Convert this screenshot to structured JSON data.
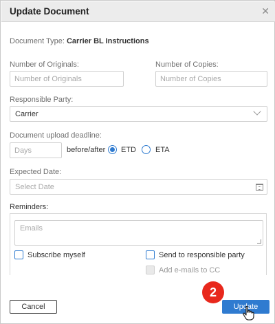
{
  "dialog": {
    "title": "Update Document",
    "close_icon": "close-icon"
  },
  "document_type": {
    "label": "Document Type:",
    "value": "Carrier BL Instructions"
  },
  "originals": {
    "label": "Number of Originals:",
    "placeholder": "Number of Originals"
  },
  "copies": {
    "label": "Number of Copies:",
    "placeholder": "Number of Copies"
  },
  "responsible_party": {
    "label": "Responsible Party:",
    "selected": "Carrier"
  },
  "deadline": {
    "label": "Document upload deadline:",
    "days_placeholder": "Days",
    "relation_label": "before/after",
    "options": [
      {
        "label": "ETD",
        "checked": true
      },
      {
        "label": "ETA",
        "checked": false
      }
    ]
  },
  "expected_date": {
    "label": "Expected Date:",
    "placeholder": "Select Date",
    "icon": "calendar-icon"
  },
  "reminders": {
    "label": "Reminders:",
    "emails_placeholder": "Emails",
    "subscribe_label": "Subscribe myself",
    "send_responsible_label": "Send to responsible party",
    "add_cc_label": "Add e-mails to CC"
  },
  "buttons": {
    "cancel": "Cancel",
    "update": "Update"
  },
  "step_badge": "2",
  "colors": {
    "accent": "#2f7bd0",
    "badge": "#e8281c",
    "header_bg": "#ececec"
  }
}
